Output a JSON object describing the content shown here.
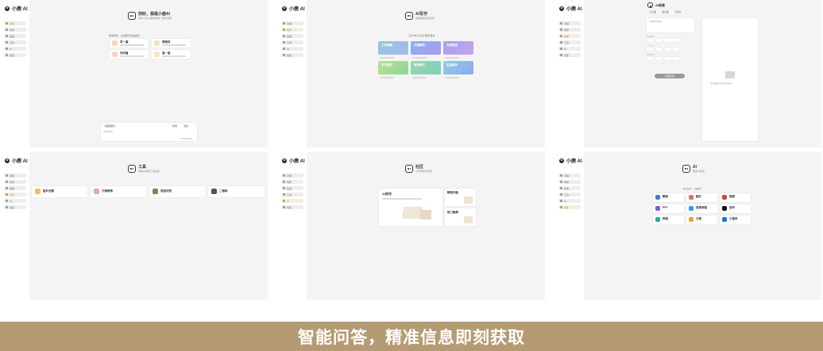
{
  "app": {
    "name": "小鹿 AI"
  },
  "nav_items": [
    "对话",
    "写作",
    "绘画",
    "工具",
    "AI",
    "社区"
  ],
  "panels": [
    {
      "header_title": "你好，我是小鹿AI",
      "header_sub": "有什么可以帮你的吗？随时问我",
      "section_label": "猜你想问，点击即可快速提问",
      "suggestions": [
        "写一篇",
        "帮我写",
        "问问看",
        "查一查"
      ],
      "input_hint": "深度思考",
      "input_action": "联网",
      "input_send": "发送"
    },
    {
      "header_title": "AI写作",
      "header_sub": "选择模板开始创作",
      "section_label": "工作  学习  生活  营销  更多",
      "tiles": [
        "工作周报",
        "文案撰写",
        "方案策划",
        "学习笔记",
        "营销推文",
        "生活助手"
      ]
    },
    {
      "header_title": "AI绘画",
      "tabs": [
        "文生图",
        "图生图",
        "风格化"
      ],
      "generate_button": "立即生成",
      "preview_hint": "生成的图片将在这里展示"
    },
    {
      "header_title": "工具",
      "header_sub": "常用AI效率工具合集",
      "tools": [
        "图片处理",
        "文档转换",
        "语音识别",
        "二维码"
      ]
    },
    {
      "header_title": "社区",
      "header_sub": "分享你的AI创作",
      "feature_title": "AI创作",
      "side_cards": [
        "精选作品",
        "热门推荐"
      ]
    },
    {
      "header_title": "AI",
      "header_sub": "更多AI应用",
      "section_label": "热门应用，一键直达",
      "apps": [
        "翻译",
        "图片",
        "视频",
        "PPT",
        "思维导图",
        "音乐",
        "表格",
        "文档",
        "小程序"
      ]
    }
  ],
  "banner": {
    "text": "智能问答，精准信息即刻获取"
  },
  "colors": {
    "banner": "#b59b74",
    "accent": "#c49a55"
  }
}
